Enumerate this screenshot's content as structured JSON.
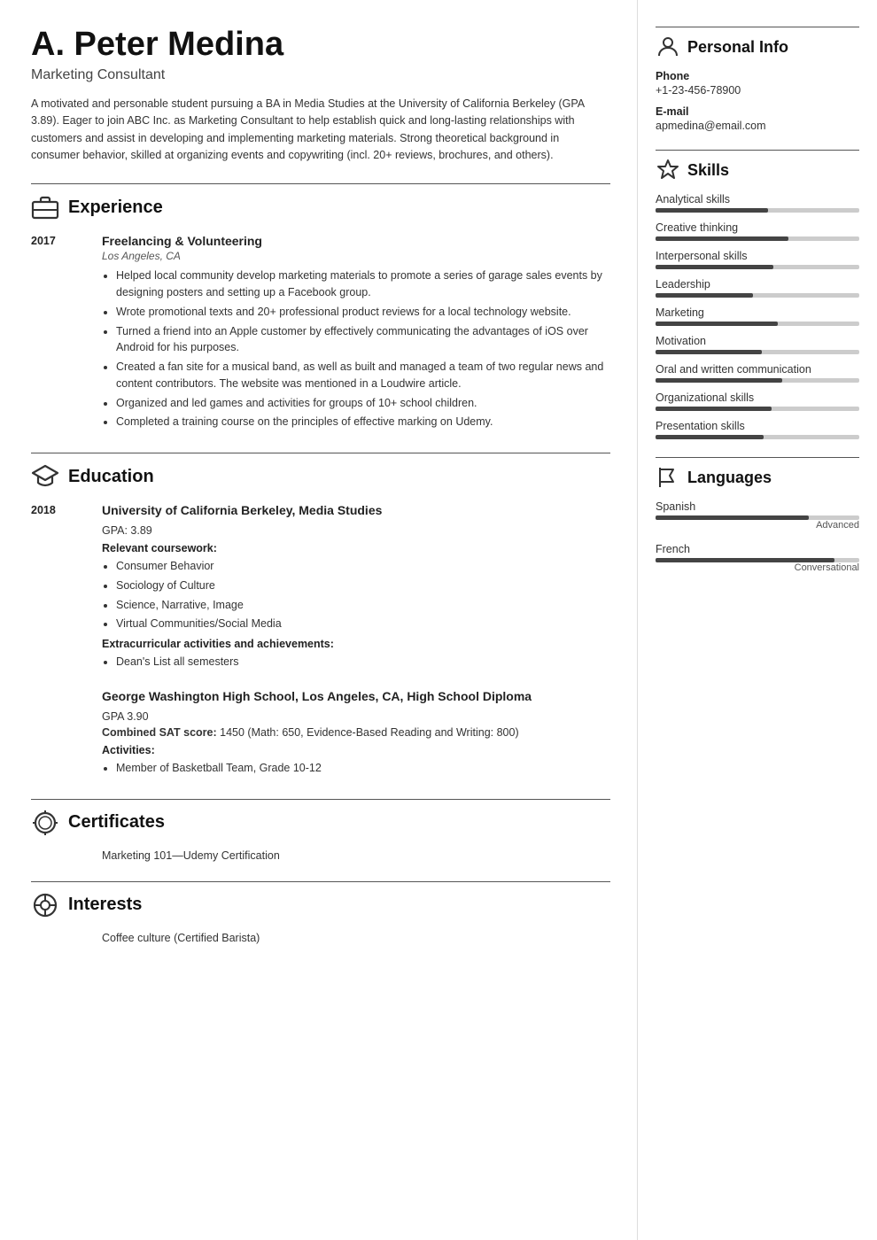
{
  "header": {
    "name": "A. Peter Medina",
    "title": "Marketing Consultant",
    "summary": "A motivated and personable student pursuing a BA in Media Studies at the University of California Berkeley (GPA 3.89). Eager to join ABC Inc. as Marketing Consultant to help establish quick and long-lasting relationships with customers and assist in developing and implementing marketing materials. Strong theoretical background in consumer behavior, skilled at organizing events and copywriting (incl. 20+ reviews, brochures, and others)."
  },
  "sections": {
    "experience": {
      "label": "Experience",
      "entries": [
        {
          "year": "2017",
          "title": "Freelancing & Volunteering",
          "subtitle": "Los Angeles, CA",
          "bullets": [
            "Helped local community develop marketing materials to promote a series of garage sales events by designing posters and setting up a Facebook group.",
            "Wrote promotional texts and 20+ professional product reviews for a local technology website.",
            "Turned a friend into an Apple customer by effectively communicating the advantages of iOS over Android for his purposes.",
            "Created a fan site for a musical band, as well as built and managed a team of two regular news and content contributors. The website was mentioned in a Loudwire article.",
            "Organized and led games and activities for groups of 10+ school children.",
            "Completed a training course on the principles of effective marking on Udemy."
          ]
        }
      ]
    },
    "education": {
      "label": "Education",
      "entries": [
        {
          "year": "2018",
          "title": "University of California Berkeley, Media Studies",
          "subtitle": "",
          "gpa": "GPA: 3.89",
          "coursework_label": "Relevant coursework:",
          "coursework": [
            "Consumer Behavior",
            "Sociology of Culture",
            "Science, Narrative, Image",
            "Virtual Communities/Social Media"
          ],
          "extra_label": "Extracurricular activities and achievements:",
          "extra": [
            "Dean's List all semesters"
          ]
        },
        {
          "year": "",
          "title": "George Washington High School, Los Angeles, CA, High School Diploma",
          "subtitle": "",
          "gpa": "GPA 3.90",
          "sat_label": "Combined SAT score:",
          "sat_value": "1450 (Math: 650, Evidence-Based Reading and Writing: 800)",
          "activities_label": "Activities:",
          "activities": [
            "Member of Basketball Team, Grade 10-12"
          ]
        }
      ]
    },
    "certificates": {
      "label": "Certificates",
      "items": [
        "Marketing 101—Udemy Certification"
      ]
    },
    "interests": {
      "label": "Interests",
      "items": [
        "Coffee culture (Certified Barista)"
      ]
    }
  },
  "right": {
    "personal_info": {
      "label": "Personal Info",
      "phone_label": "Phone",
      "phone": "+1-23-456-78900",
      "email_label": "E-mail",
      "email": "apmedina@email.com"
    },
    "skills": {
      "label": "Skills",
      "items": [
        {
          "name": "Analytical skills",
          "pct": 55
        },
        {
          "name": "Creative thinking",
          "pct": 65
        },
        {
          "name": "Interpersonal skills",
          "pct": 58
        },
        {
          "name": "Leadership",
          "pct": 48
        },
        {
          "name": "Marketing",
          "pct": 60
        },
        {
          "name": "Motivation",
          "pct": 52
        },
        {
          "name": "Oral and written communication",
          "pct": 62
        },
        {
          "name": "Organizational skills",
          "pct": 57
        },
        {
          "name": "Presentation skills",
          "pct": 53
        }
      ]
    },
    "languages": {
      "label": "Languages",
      "items": [
        {
          "name": "Spanish",
          "pct": 75,
          "level": "Advanced"
        },
        {
          "name": "French",
          "pct": 88,
          "level": "Conversational"
        }
      ]
    }
  }
}
